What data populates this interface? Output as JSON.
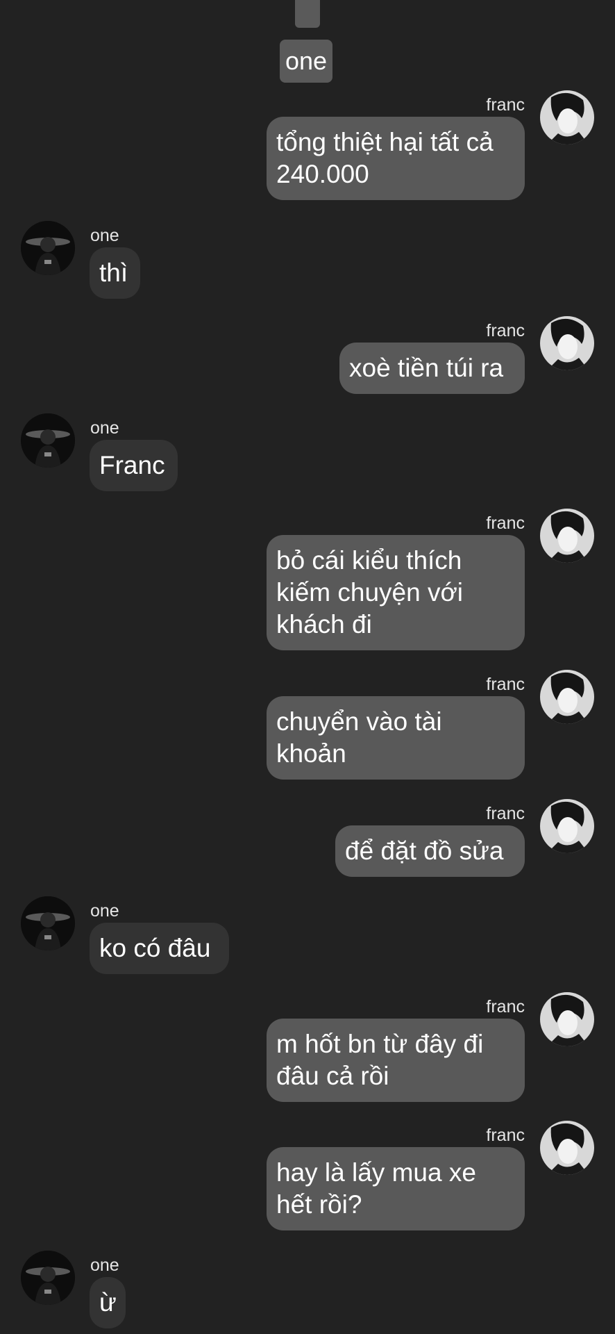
{
  "top": {
    "label": "one"
  },
  "messages": [
    {
      "side": "out",
      "sender": "franc",
      "lines": [
        "tổng thiệt hại tất cả",
        "240.000"
      ]
    },
    {
      "side": "in",
      "sender": "one",
      "lines": [
        "thì"
      ]
    },
    {
      "side": "out",
      "sender": "franc",
      "lines": [
        "xoè tiền túi ra"
      ]
    },
    {
      "side": "in",
      "sender": "one",
      "lines": [
        "Franc"
      ]
    },
    {
      "side": "out",
      "sender": "franc",
      "lines": [
        "bỏ cái kiểu thích",
        "kiếm chuyện với",
        "khách đi"
      ]
    },
    {
      "side": "out",
      "sender": "franc",
      "lines": [
        "chuyển vào tài",
        "khoản"
      ]
    },
    {
      "side": "out",
      "sender": "franc",
      "lines": [
        "để đặt đồ sửa"
      ]
    },
    {
      "side": "in",
      "sender": "one",
      "lines": [
        "ko có đâu"
      ]
    },
    {
      "side": "out",
      "sender": "franc",
      "lines": [
        "m hốt bn từ đây đi",
        "đâu cả rồi"
      ]
    },
    {
      "side": "out",
      "sender": "franc",
      "lines": [
        "hay là lấy mua xe",
        "hết rồi?"
      ]
    },
    {
      "side": "in",
      "sender": "one",
      "lines": [
        "ừ"
      ]
    }
  ],
  "colors": {
    "background": "#222222",
    "bubble_out": "#595959",
    "bubble_in": "#333333",
    "text": "#ffffff"
  }
}
